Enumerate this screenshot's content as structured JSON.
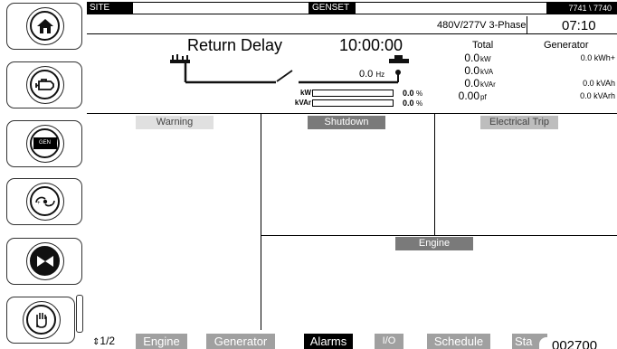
{
  "header": {
    "site_label": "SITE",
    "genset_label": "GENSET",
    "device_ids": "7741 \\ 7740",
    "voltage_config": "480V/277V 3-Phase",
    "clock": "07:10"
  },
  "status": {
    "state_label": "Return Delay",
    "timer": "10:00:00",
    "frequency_value": "0.0",
    "frequency_unit": "Hz"
  },
  "load_bars": [
    {
      "label": "kW",
      "value": "0.0",
      "unit": "%",
      "percent": 0
    },
    {
      "label": "kVAr",
      "value": "0.0",
      "unit": "%",
      "percent": 0
    }
  ],
  "totals": {
    "header": "Total",
    "rows": [
      {
        "value": "0.0",
        "unit": "kW"
      },
      {
        "value": "0.0",
        "unit": "kVA"
      },
      {
        "value": "0.0",
        "unit": "kVAr"
      },
      {
        "value": "0.00",
        "unit": "pf"
      }
    ]
  },
  "generator": {
    "header": "Generator",
    "rows": [
      {
        "value": "0.0",
        "unit": "kWh+"
      },
      {
        "value": "",
        "unit": ""
      },
      {
        "value": "0.0",
        "unit": "kVAh"
      },
      {
        "value": "0.0",
        "unit": "kVArh"
      }
    ]
  },
  "panels": {
    "warning": "Warning",
    "shutdown": "Shutdown",
    "electrical_trip": "Electrical Trip",
    "engine": "Engine"
  },
  "left_buttons": [
    {
      "icon": "home-icon"
    },
    {
      "icon": "engine-icon"
    },
    {
      "icon": "generator-icon",
      "text": "GEN"
    },
    {
      "icon": "auto-mode-icon"
    },
    {
      "icon": "stop-icon"
    },
    {
      "icon": "manual-hand-icon"
    }
  ],
  "bottom_nav": {
    "page_indicator": "1/2",
    "tabs": [
      "Engine",
      "Generator",
      "Alarms",
      "I/O",
      "Schedule",
      "Sta"
    ],
    "active_tab": "Alarms",
    "overlay_text": "002700"
  },
  "colors": {
    "header_bg": "#000000",
    "tab_inactive": "#a0a0a0",
    "tab_active": "#000000",
    "panel_header_light": "#e0e0e0",
    "panel_header_dark": "#7a7a7a",
    "panel_header_mid": "#bdbdbd"
  }
}
